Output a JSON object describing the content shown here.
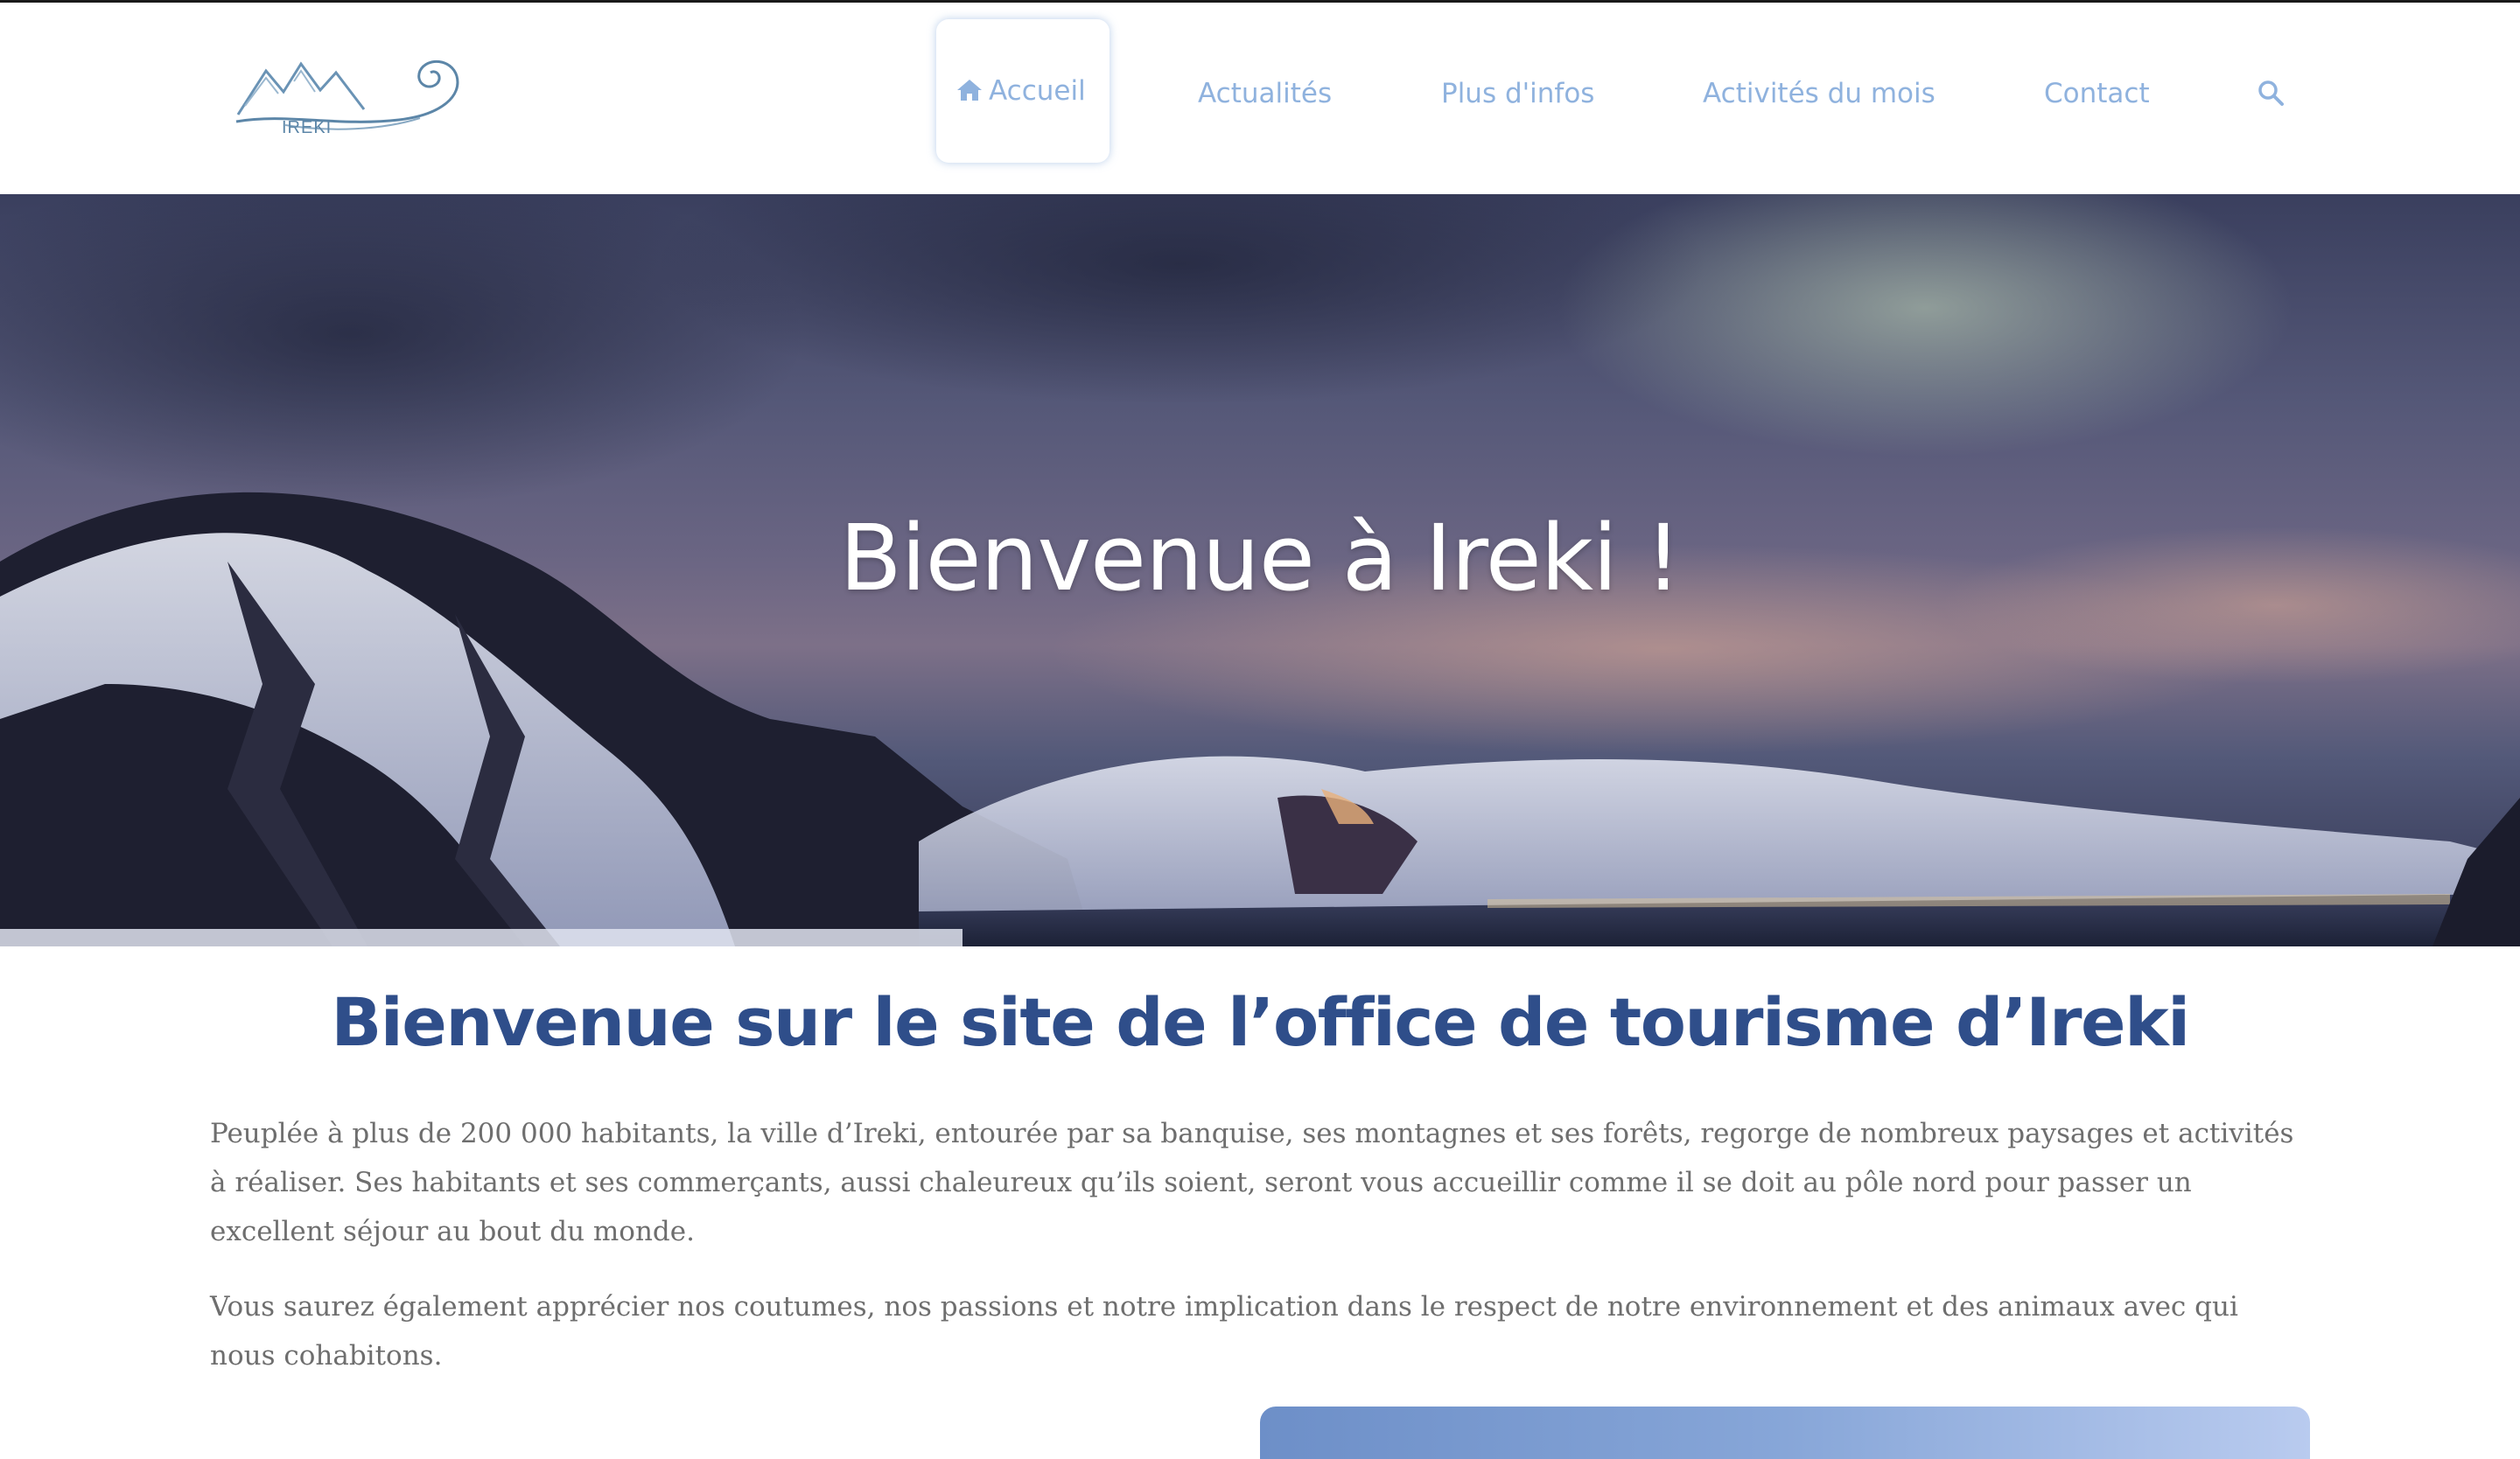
{
  "brand": {
    "logo_text": "IREKI"
  },
  "nav": {
    "items": [
      {
        "label": "Accueil",
        "active": true
      },
      {
        "label": "Actualités"
      },
      {
        "label": "Plus d'infos"
      },
      {
        "label": "Activités du mois"
      },
      {
        "label": "Contact"
      }
    ],
    "search_icon": "search-icon",
    "home_icon": "home-icon"
  },
  "hero": {
    "title": "Bienvenue à Ireki !"
  },
  "main": {
    "title": "Bienvenue sur le site de l’office de tourisme d’Ireki",
    "paragraphs": [
      "Peuplée à plus de 200 000 habitants, la ville d’Ireki, entourée par sa banquise, ses montagnes et ses forêts, regorge de nombreux paysages et activités à réaliser. Ses habitants et ses commerçants, aussi chaleureux qu’ils soient, seront vous accueillir comme il se doit au pôle nord pour passer un excellent séjour au bout du monde.",
      "Vous saurez également apprécier nos coutumes, nos passions et notre implication dans le respect de notre environnement et des animaux avec qui nous cohabitons."
    ]
  },
  "colors": {
    "nav_text": "#8fb2de",
    "title_blue": "#2f4e8a",
    "body_text": "#6e6e6e"
  }
}
